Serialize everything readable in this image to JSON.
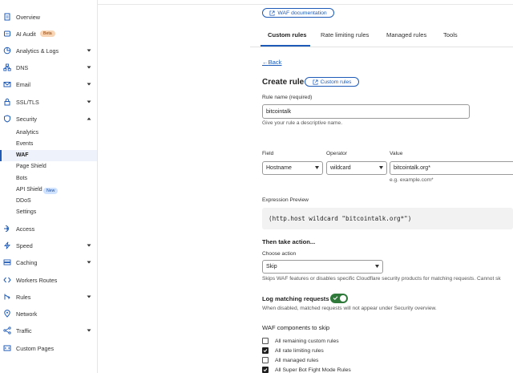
{
  "sidebar": {
    "items": [
      {
        "label": "Overview",
        "icon": "document-icon"
      },
      {
        "label": "AI Audit",
        "icon": "ai-audit-icon",
        "badge": "Beta"
      },
      {
        "label": "Analytics & Logs",
        "icon": "analytics-icon",
        "chevron": "down"
      },
      {
        "label": "DNS",
        "icon": "dns-icon",
        "chevron": "down"
      },
      {
        "label": "Email",
        "icon": "email-icon",
        "chevron": "down"
      },
      {
        "label": "SSL/TLS",
        "icon": "lock-icon",
        "chevron": "down"
      },
      {
        "label": "Security",
        "icon": "shield-icon",
        "chevron": "up"
      }
    ],
    "security_sub": [
      "Analytics",
      "Events",
      "WAF",
      "Page Shield",
      "Bots",
      "API Shield",
      "DDoS",
      "Settings"
    ],
    "api_shield_badge": "New",
    "items_after": [
      {
        "label": "Access",
        "icon": "access-icon"
      },
      {
        "label": "Speed",
        "icon": "speed-icon",
        "chevron": "down"
      },
      {
        "label": "Caching",
        "icon": "caching-icon",
        "chevron": "down"
      },
      {
        "label": "Workers Routes",
        "icon": "workers-icon"
      },
      {
        "label": "Rules",
        "icon": "rules-icon",
        "chevron": "down"
      },
      {
        "label": "Network",
        "icon": "network-icon"
      },
      {
        "label": "Traffic",
        "icon": "traffic-icon",
        "chevron": "down"
      },
      {
        "label": "Custom Pages",
        "icon": "custom-pages-icon"
      }
    ]
  },
  "header": {
    "doc_button": "WAF documentation",
    "tabs": [
      "Custom rules",
      "Rate limiting rules",
      "Managed rules",
      "Tools"
    ],
    "active_tab": "Custom rules"
  },
  "form": {
    "back": "Back",
    "title": "Create rule",
    "title_pill": "Custom rules",
    "rule_name_label": "Rule name (required)",
    "rule_name_value": "bitcointalk",
    "rule_name_hint": "Give your rule a descriptive name.",
    "field_label": "Field",
    "field_value": "Hostname",
    "operator_label": "Operator",
    "operator_value": "wildcard",
    "value_label": "Value",
    "value_value": "bitcointalk.org*",
    "value_hint": "e.g. example.com*",
    "expression_label": "Expression Preview",
    "expression": "(http.host wildcard \"bitcointalk.org*\")",
    "action_heading": "Then take action...",
    "choose_action_label": "Choose action",
    "action_value": "Skip",
    "action_hint": "Skips WAF features or disables specific Cloudflare security products for matching requests. Cannot sk",
    "log_label": "Log matching requests",
    "log_enabled": true,
    "log_hint": "When disabled, matched requests will not appear under Security overview.",
    "skip_heading": "WAF components to skip",
    "components": [
      {
        "label": "All remaining custom rules",
        "checked": false
      },
      {
        "label": "All rate limiting rules",
        "checked": true
      },
      {
        "label": "All managed rules",
        "checked": false
      },
      {
        "label": "All Super Bot Fight Mode Rules",
        "checked": true
      }
    ]
  },
  "colors": {
    "accent": "#1e5bb8",
    "toggle_on": "#2f7a3a"
  }
}
